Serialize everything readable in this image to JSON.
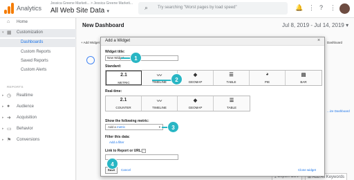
{
  "topbar": {
    "app_name": "Analytics",
    "account_path": "Jessica Greene Marketi... > Jessica Greene Marketi...",
    "view_name": "All Web Site Data",
    "search_placeholder": "Try searching \"Worst pages by load speed\""
  },
  "sidebar": {
    "items": [
      {
        "label": "Home"
      },
      {
        "label": "Customization"
      },
      {
        "label": "Dashboards"
      },
      {
        "label": "Custom Reports"
      },
      {
        "label": "Saved Reports"
      },
      {
        "label": "Custom Alerts"
      }
    ],
    "reports_header": "REPORTS",
    "report_items": [
      {
        "label": "Realtime"
      },
      {
        "label": "Audience"
      },
      {
        "label": "Acquisition"
      },
      {
        "label": "Behavior"
      },
      {
        "label": "Conversions"
      }
    ]
  },
  "main": {
    "title": "New Dashboard",
    "date_range": "Jul 8, 2019 - Jul 14, 2019",
    "add_widget_link": "+ Add Widget",
    "side_dashboard": "Dashboard",
    "side_add": "...ize Dashboard",
    "export_csv": "Export CSV",
    "add_keywords": "Add All Keywords"
  },
  "modal": {
    "title": "Add a Widget",
    "widget_title_label": "Widget title:",
    "widget_title_value": "New Widget",
    "standard_label": "Standard:",
    "standard_options": [
      {
        "label": "METRIC",
        "icon_text": "2.1"
      },
      {
        "label": "TIMELINE",
        "icon": "timeline-icon"
      },
      {
        "label": "GEOMAP",
        "icon": "geomap-icon"
      },
      {
        "label": "TABLE",
        "icon": "table-icon"
      },
      {
        "label": "PIE",
        "icon": "pie-icon"
      },
      {
        "label": "BAR",
        "icon": "bar-icon"
      }
    ],
    "realtime_label": "Real-time:",
    "realtime_options": [
      {
        "label": "COUNTER",
        "icon_text": "2.1"
      },
      {
        "label": "TIMELINE",
        "icon": "timeline-icon"
      },
      {
        "label": "GEOMAP",
        "icon": "geomap-icon"
      },
      {
        "label": "TABLE",
        "icon": "table-icon"
      }
    ],
    "metric_label": "Show the following metric:",
    "metric_select_prefix": "Add a ",
    "metric_select_link": "metric",
    "filter_label": "Filter this data:",
    "add_filter": "Add a filter",
    "link_label": "Link to Report or URL:",
    "save": "Save",
    "cancel": "Cancel",
    "clone": "Clone widget"
  },
  "callouts": [
    "1",
    "2",
    "3",
    "4"
  ],
  "colors": {
    "callout": "#29b6c4",
    "link": "#1a73e8",
    "brand": "#f57c00"
  }
}
